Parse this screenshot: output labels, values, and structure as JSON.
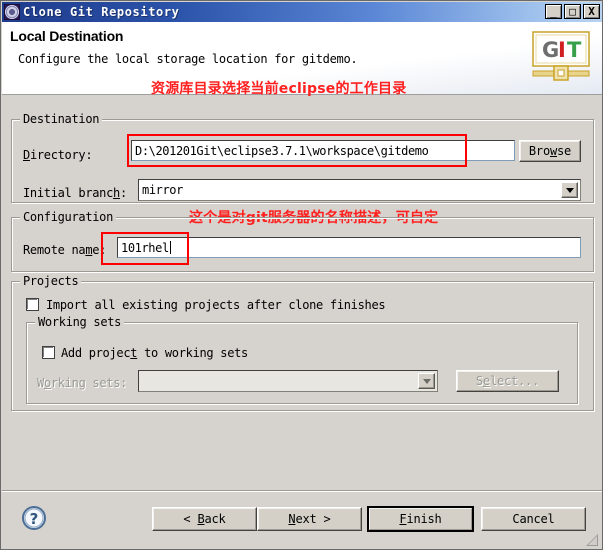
{
  "window": {
    "title": "Clone Git Repository",
    "icon": "gear-icon",
    "controls": {
      "minimize": "_",
      "maximize": "□",
      "close": "X"
    }
  },
  "header": {
    "title": "Local Destination",
    "description": "Configure the local storage location for gitdemo.",
    "logo_text": {
      "g": "G",
      "i": "I",
      "t": "T"
    }
  },
  "annotations": [
    {
      "text": "资源库目录选择当前eclipse的工作目录",
      "color": "#ff2020"
    },
    {
      "text": "这个是对git服务器的名称描述，可自定",
      "color": "#ff2020"
    }
  ],
  "destination": {
    "group_title": "Destination",
    "directory_label": "Directory:",
    "directory_value": "D:\\201201Git\\eclipse3.7.1\\workspace\\gitdemo",
    "browse_label": "Browse",
    "initial_branch_label": "Initial branch:",
    "initial_branch_value": "mirror"
  },
  "configuration": {
    "group_title": "Configuration",
    "remote_name_label": "Remote name:",
    "remote_name_value": "101rhel"
  },
  "projects": {
    "group_title": "Projects",
    "import_all_label": "Import all existing projects after clone finishes",
    "import_all_checked": false,
    "working_sets": {
      "group_title": "Working sets",
      "add_project_label": "Add project to working sets",
      "add_project_checked": false,
      "working_sets_label": "Working sets:",
      "working_sets_value": "",
      "select_label": "Select...",
      "disabled": true
    }
  },
  "footer": {
    "help_icon": "question-mark-icon",
    "back_label": "< Back",
    "next_label": "Next >",
    "finish_label": "Finish",
    "cancel_label": "Cancel"
  }
}
